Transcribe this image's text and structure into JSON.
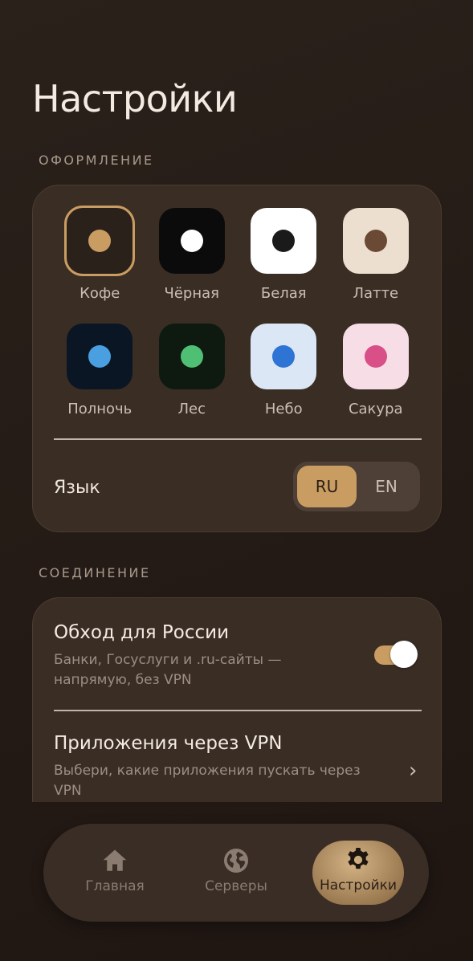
{
  "page_title": "Настройки",
  "appearance": {
    "section_label": "ОФОРМЛЕНИЕ",
    "themes": [
      {
        "label": "Кофе",
        "bg": "#2b211b",
        "dot": "#c99d62",
        "selected": true
      },
      {
        "label": "Чёрная",
        "bg": "#0b0b0b",
        "dot": "#ffffff",
        "selected": false
      },
      {
        "label": "Белая",
        "bg": "#ffffff",
        "dot": "#1a1a1a",
        "selected": false
      },
      {
        "label": "Латте",
        "bg": "#ecdfd0",
        "dot": "#6b4a35",
        "selected": false
      },
      {
        "label": "Полночь",
        "bg": "#0b1624",
        "dot": "#4a9fe0",
        "selected": false
      },
      {
        "label": "Лес",
        "bg": "#0e1a10",
        "dot": "#4fbf74",
        "selected": false
      },
      {
        "label": "Небо",
        "bg": "#dce7f5",
        "dot": "#2e74d4",
        "selected": false
      },
      {
        "label": "Сакура",
        "bg": "#f6dde6",
        "dot": "#d94f87",
        "selected": false
      }
    ],
    "language": {
      "label": "Язык",
      "options": [
        {
          "label": "RU",
          "active": true
        },
        {
          "label": "EN",
          "active": false
        }
      ]
    }
  },
  "connection": {
    "section_label": "СОЕДИНЕНИЕ",
    "bypass": {
      "title": "Обход для России",
      "subtitle": "Банки, Госуслуги и .ru-сайты — напрямую, без VPN",
      "enabled": true
    },
    "apps": {
      "title": "Приложения через VPN",
      "subtitle": "Выбери, какие приложения пускать через VPN",
      "chevron": "›"
    }
  },
  "bottom_nav": {
    "items": [
      {
        "label": "Главная",
        "icon": "home-icon",
        "active": false
      },
      {
        "label": "Серверы",
        "icon": "globe-icon",
        "active": false
      },
      {
        "label": "Настройки",
        "icon": "gear-icon",
        "active": true
      }
    ]
  },
  "colors": {
    "accent": "#c99d62",
    "card": "#3a2d24",
    "background": "#241a15"
  }
}
